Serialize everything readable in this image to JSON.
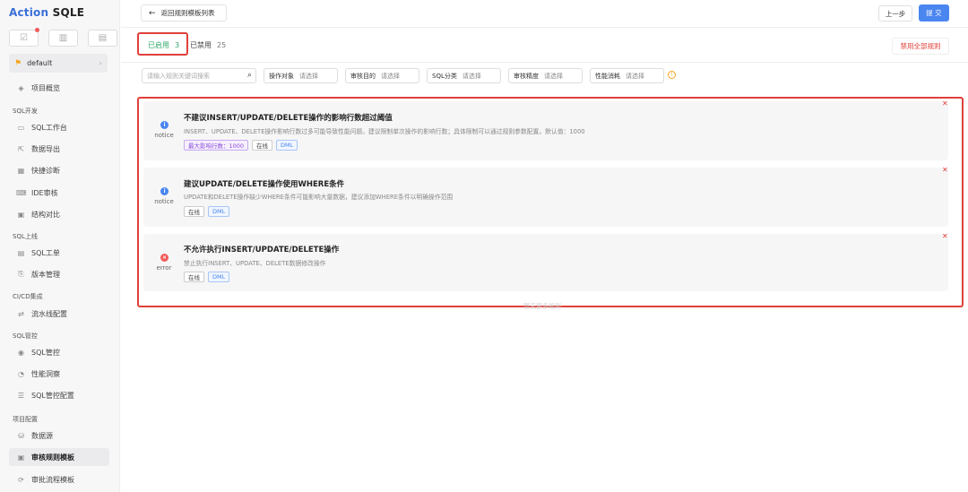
{
  "app": {
    "logo_action": "Action",
    "logo_sqle": "SQLE"
  },
  "sidebar": {
    "quick_icons": [
      "checklist-icon",
      "chart-icon",
      "note-icon"
    ],
    "project": "default",
    "groups": {
      "sql_dev": "SQL开发",
      "sql_release": "SQL上线",
      "cicd": "CI/CD集成",
      "sql_control": "SQL管控",
      "project_config": "项目配置"
    },
    "items": {
      "overview": "项目概览",
      "workbench": "SQL工作台",
      "export": "数据导出",
      "diagnosis": "快捷诊断",
      "ide_audit": "IDE审核",
      "schema_compare": "结构对比",
      "sql_ticket": "SQL工单",
      "version": "版本管理",
      "pipeline": "流水线配置",
      "sql_manage": "SQL管控",
      "perf": "性能洞察",
      "sql_manage_config": "SQL管控配置",
      "datasource": "数据源",
      "rule_template": "审核规则模板",
      "flow_template": "审批流程模板"
    }
  },
  "header": {
    "back": "返回规则模板列表",
    "prev": "上一步",
    "submit": "提 交"
  },
  "tabs": {
    "enabled_label": "已启用",
    "enabled_count": "3",
    "disabled_label": "已禁用",
    "disabled_count": "25",
    "disable_all": "禁用全部规则"
  },
  "filters": {
    "search_placeholder": "请输入规则关键词搜索",
    "items": [
      {
        "label": "操作对象",
        "placeholder": "请选择"
      },
      {
        "label": "审核目的",
        "placeholder": "请选择"
      },
      {
        "label": "SQL分类",
        "placeholder": "请选择"
      },
      {
        "label": "审核精度",
        "placeholder": "请选择"
      },
      {
        "label": "性能消耗",
        "placeholder": "请选择"
      }
    ]
  },
  "rules": [
    {
      "level": "notice",
      "title": "不建议INSERT/UPDATE/DELETE操作的影响行数超过阈值",
      "desc": "INSERT、UPDATE、DELETE操作影响行数过多可能导致性能问题。建议限制单次操作的影响行数；具体限制可以通过规则参数配置。默认值：1000",
      "param_tag": "最大影响行数：1000",
      "tags": [
        "在线",
        "DML"
      ]
    },
    {
      "level": "notice",
      "title": "建议UPDATE/DELETE操作使用WHERE条件",
      "desc": "UPDATE和DELETE操作缺少WHERE条件可能影响大量数据，建议添加WHERE条件以明确操作范围",
      "tags": [
        "在线",
        "DML"
      ]
    },
    {
      "level": "error",
      "title": "不允许执行INSERT/UPDATE/DELETE操作",
      "desc": "禁止执行INSERT、UPDATE、DELETE数据修改操作",
      "tags": [
        "在线",
        "DML"
      ]
    }
  ],
  "footer": {
    "no_more": "暂无更多规则"
  }
}
